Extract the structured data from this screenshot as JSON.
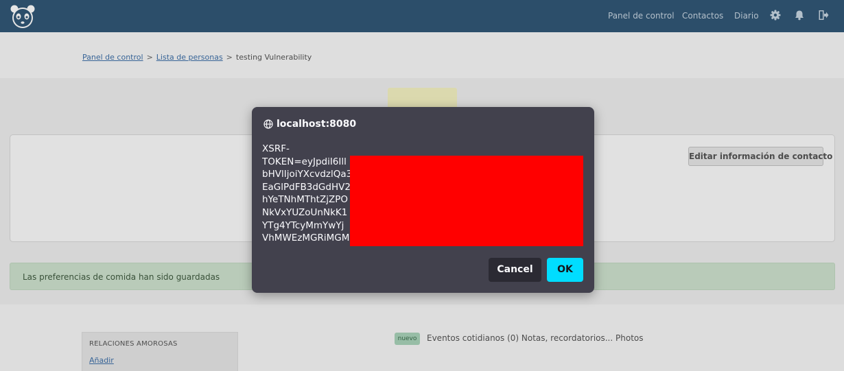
{
  "topbar": {
    "logo_icon": "panda-logo-icon",
    "nav": [
      {
        "label": "Panel de control"
      },
      {
        "label": "Contactos"
      },
      {
        "label": "Diario"
      }
    ],
    "icons": [
      "gear-icon",
      "bell-icon",
      "logout-icon"
    ]
  },
  "breadcrumb": {
    "items": [
      {
        "label": "Panel de control"
      },
      {
        "label": "Lista de personas"
      }
    ],
    "current": "testing Vulnerability"
  },
  "contact": {
    "edit_label": "Editar información de contacto"
  },
  "alert": {
    "message": "Las preferencias de comida han sido guardadas"
  },
  "sidebar": {
    "section_title": "RELACIONES AMOROSAS",
    "add_label": "Añadir"
  },
  "feed": {
    "badge": "nuevo",
    "text": "Eventos cotidianos (0) Notas, recordatorios... Photos"
  },
  "dialog": {
    "origin": "localhost:8080",
    "origin_icon": "globe-icon",
    "message_lines": [
      "XSRF-",
      "TOKEN=eyJpdiI6Ill",
      "bHVlIjoiYXcvdzlQa3",
      "EaGlPdFB3dGdHV2",
      "hYeTNhMThtZjZPO",
      "NkVxYUZoUnNkK1",
      "YTg4YTcyMmYwYj",
      "VhMWEzMGRiMGM"
    ],
    "cancel_label": "Cancel",
    "ok_label": "OK"
  },
  "colors": {
    "topbar": "#325776",
    "dialog_bg": "#42414d",
    "ok_button": "#00ddff",
    "cancel_button": "#2b2a33",
    "redaction": "#ff0000"
  }
}
